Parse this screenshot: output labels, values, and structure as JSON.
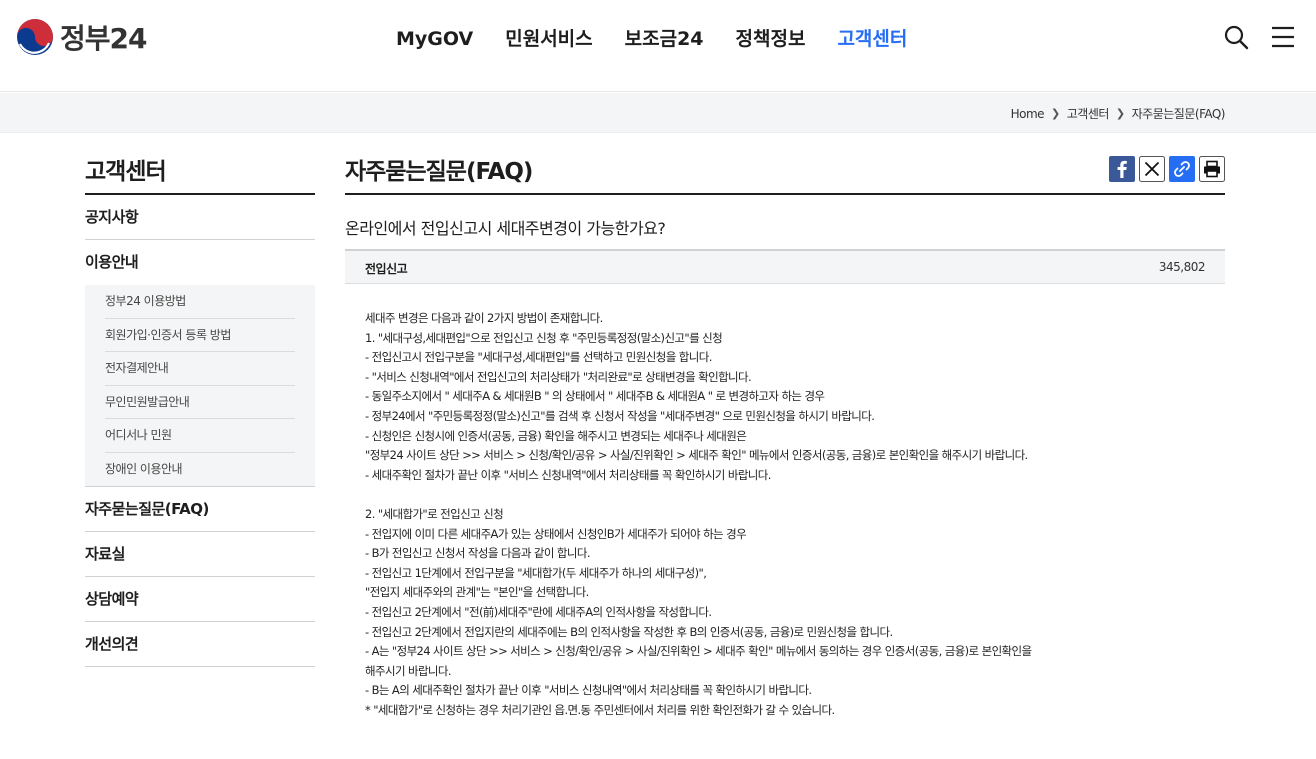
{
  "header": {
    "logo_text": "정부24",
    "nav": [
      "MyGOV",
      "민원서비스",
      "보조금24",
      "정책정보",
      "고객센터"
    ],
    "active_nav": "고객센터",
    "icons": [
      "search-icon",
      "menu-icon"
    ]
  },
  "breadcrumb": [
    "Home",
    "고객센터",
    "자주묻는질문(FAQ)"
  ],
  "sidebar": {
    "title": "고객센터",
    "items": [
      {
        "label": "공지사항"
      },
      {
        "label": "이용안내",
        "sub": [
          "정부24 이용방법",
          "회원가입·인증서 등록 방법",
          "전자결제안내",
          "무인민원발급안내",
          "어디서나 민원",
          "장애인 이용안내"
        ]
      },
      {
        "label": "자주묻는질문(FAQ)"
      },
      {
        "label": "자료실"
      },
      {
        "label": "상담예약"
      },
      {
        "label": "개선의견"
      }
    ]
  },
  "main": {
    "title": "자주묻는질문(FAQ)",
    "share_icons": [
      "facebook-icon",
      "x-icon",
      "link-icon",
      "print-icon"
    ],
    "question": "온라인에서 전입신고시 세대주변경이 가능한가요?",
    "category": "전입신고",
    "views": "345,802",
    "answer_lines": [
      "세대주 변경은 다음과 같이 2가지 방법이 존재합니다.",
      "1. \"세대구성,세대편입\"으로 전입신고 신청 후 \"주민등록정정(말소)신고\"를 신청",
      "- 전입신고시 전입구분을 \"세대구성,세대편입\"를 선택하고 민원신청을 합니다.",
      "- \"서비스 신청내역\"에서 전입신고의 처리상태가 \"처리완료\"로 상태변경을 확인합니다.",
      "- 동일주소지에서 \" 세대주A & 세대원B \" 의 상태에서 \" 세대주B & 세대원A \" 로 변경하고자 하는 경우",
      "- 정부24에서 \"주민등록정정(말소)신고\"를 검색 후 신청서 작성을 \"세대주변경\" 으로 민원신청을 하시기 바랍니다.",
      "- 신청인은 신청시에 인증서(공동, 금융) 확인을 해주시고 변경되는 세대주나 세대원은",
      "\"정부24 사이트 상단 >> 서비스 > 신청/확인/공유 > 사실/진위확인 > 세대주 확인\" 메뉴에서 인증서(공동, 금융)로 본인확인을 해주시기 바랍니다.",
      "- 세대주확인 절차가 끝난 이후 \"서비스 신청내역\"에서 처리상태를 꼭 확인하시기 바랍니다.",
      "",
      "2. \"세대합가\"로 전입신고 신청",
      "- 전입지에 이미 다른 세대주A가 있는 상태에서 신청인B가 세대주가 되어야 하는 경우",
      "- B가 전입신고 신청서 작성을 다음과 같이 합니다.",
      "- 전입신고 1단계에서 전입구분을 \"세대합가(두 세대주가 하나의 세대구성)\",",
      "\"전입지 세대주와의 관계\"는 \"본인\"을 선택합니다.",
      "- 전입신고 2단계에서 \"전(前)세대주\"란에 세대주A의 인적사항을 작성합니다.",
      "- 전입신고 2단계에서 전입지란의 세대주에는 B의 인적사항을 작성한 후 B의 인증서(공동, 금융)로 민원신청을 합니다.",
      "- A는 \"정부24 사이트 상단 >> 서비스 > 신청/확인/공유 > 사실/진위확인 > 세대주 확인\" 메뉴에서 동의하는 경우 인증서(공동, 금융)로 본인확인을",
      "해주시기 바랍니다.",
      "- B는 A의 세대주확인 절차가 끝난 이후 \"서비스 신청내역\"에서 처리상태를 꼭 확인하시기 바랍니다.",
      "* \"세대합가\"로 신청하는 경우 처리기관인 읍.면.동 주민센터에서 처리를 위한 확인전화가 갈 수 있습니다."
    ]
  }
}
